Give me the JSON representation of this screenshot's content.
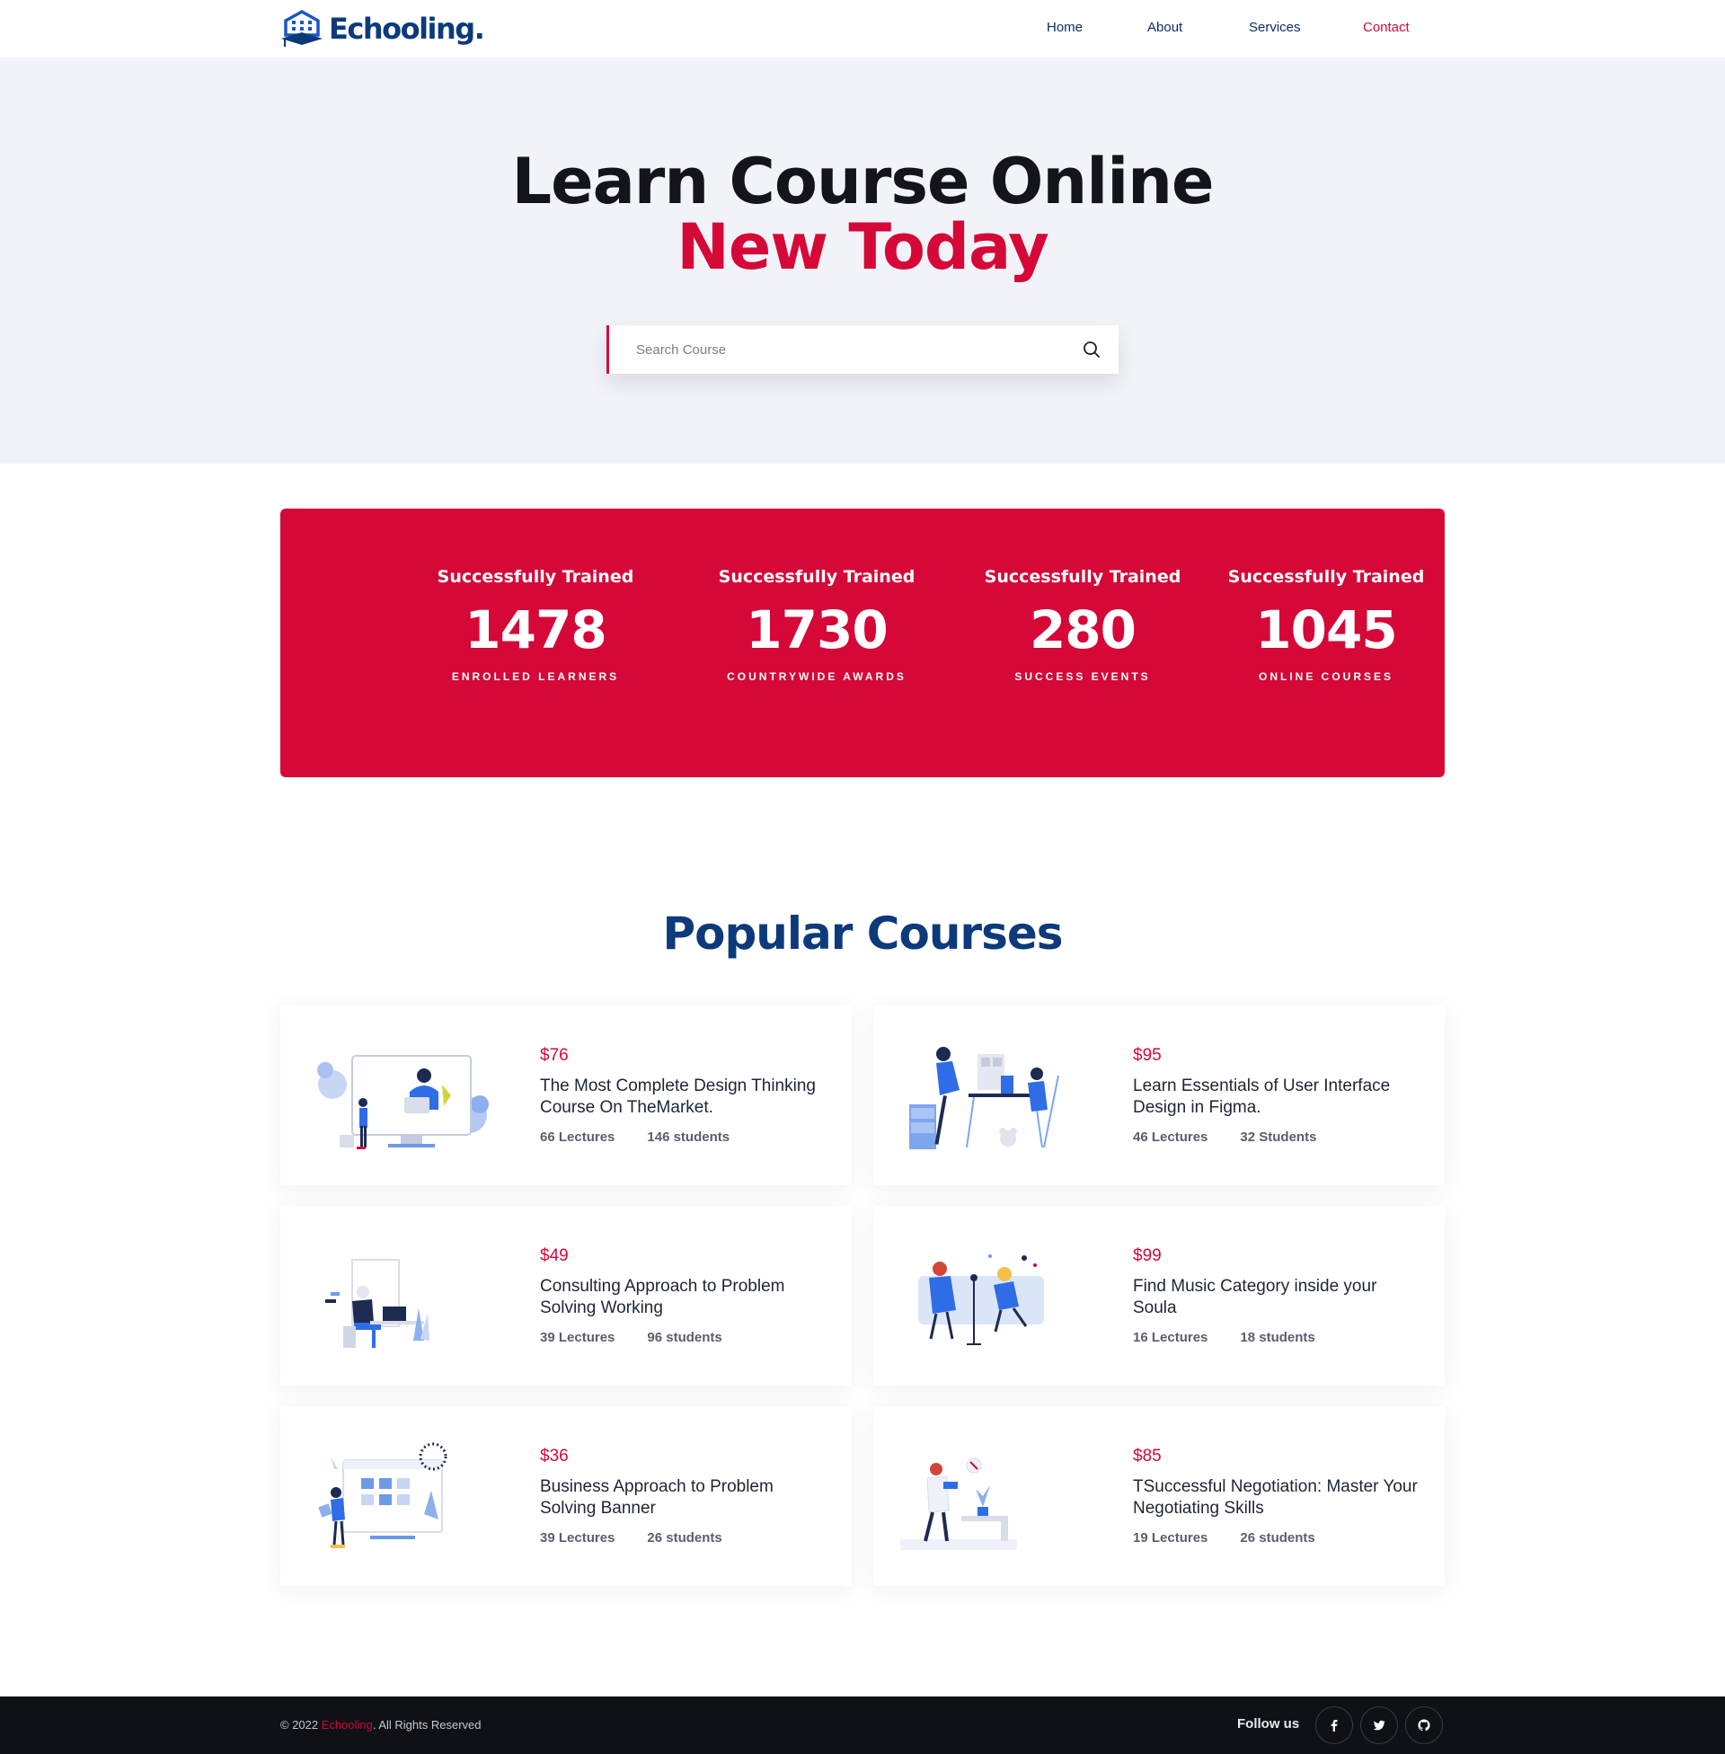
{
  "brand": {
    "name": "Echooling."
  },
  "nav": {
    "items": [
      {
        "label": "Home"
      },
      {
        "label": "About"
      },
      {
        "label": "Services"
      },
      {
        "label": "Contact",
        "active": true
      }
    ]
  },
  "hero": {
    "title_line1": "Learn Course Online",
    "title_line2": "New Today",
    "search_placeholder": "Search Course",
    "search_icon": "search-icon"
  },
  "stats": [
    {
      "title": "Successfully Trained",
      "value": "1478",
      "label": "ENROLLED LEARNERS"
    },
    {
      "title": "Successfully Trained",
      "value": "1730",
      "label": "COUNTRYWIDE AWARDS"
    },
    {
      "title": "Successfully Trained",
      "value": "280",
      "label": "SUCCESS EVENTS"
    },
    {
      "title": "Successfully Trained",
      "value": "1045",
      "label": "ONLINE COURSES"
    }
  ],
  "courses": {
    "title": "Popular Courses",
    "items": [
      {
        "price": "$76",
        "title": "The Most Complete Design Thinking Course On TheMarket.",
        "lectures": "66 Lectures",
        "students": "146 students"
      },
      {
        "price": "$95",
        "title": "Learn Essentials of User Interface Design in Figma.",
        "lectures": "46 Lectures",
        "students": "32 Students"
      },
      {
        "price": "$49",
        "title": "Consulting Approach to Problem Solving Working",
        "lectures": "39 Lectures",
        "students": "96 students"
      },
      {
        "price": "$99",
        "title": "Find Music Category inside your Soula",
        "lectures": "16 Lectures",
        "students": "18 students"
      },
      {
        "price": "$36",
        "title": "Business Approach to Problem Solving Banner",
        "lectures": "39 Lectures",
        "students": "26 students"
      },
      {
        "price": "$85",
        "title": "TSuccessful Negotiation: Master Your Negotiating Skills",
        "lectures": "19 Lectures",
        "students": "26 students"
      }
    ]
  },
  "footer": {
    "copyright_prefix": "© 2022 ",
    "copyright_brand": "Echooling",
    "copyright_suffix": ". All Rights Reserved",
    "follow_label": "Follow us",
    "socials": [
      "facebook-icon",
      "twitter-icon",
      "github-icon"
    ]
  },
  "colors": {
    "accent": "#d50838",
    "navy": "#0c3a7a",
    "hero_bg": "#f2f3f8",
    "footer_bg": "#0f1117"
  }
}
